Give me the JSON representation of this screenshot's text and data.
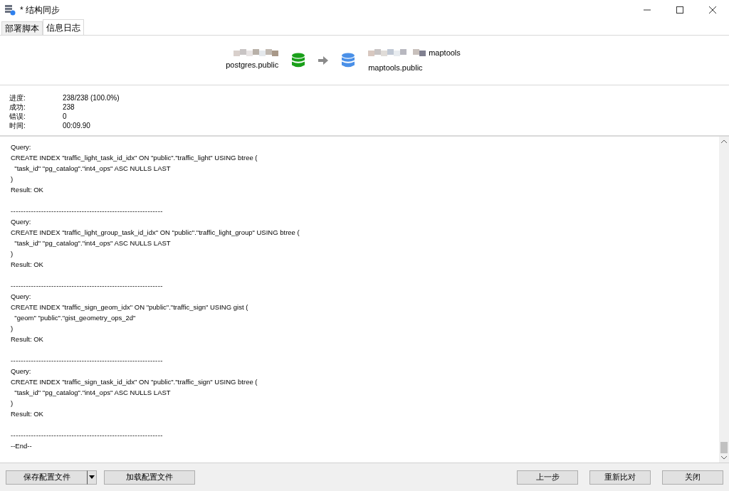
{
  "window": {
    "title": "* 结构同步"
  },
  "tabs": [
    {
      "label": "部署脚本",
      "selected": false
    },
    {
      "label": "信息日志",
      "selected": true
    }
  ],
  "source": {
    "schema": "postgres.public"
  },
  "target": {
    "name_suffix": "maptools",
    "schema": "maptools.public"
  },
  "stats": [
    {
      "label": "进度:",
      "value": "238/238 (100.0%)"
    },
    {
      "label": "成功:",
      "value": "238"
    },
    {
      "label": "错误:",
      "value": "0"
    },
    {
      "label": "时间:",
      "value": "00:09.90"
    }
  ],
  "log": [
    {
      "kind": "query",
      "label": "Query:",
      "sql": [
        "CREATE INDEX \"traffic_light_task_id_idx\" ON \"public\".\"traffic_light\" USING btree (",
        "  \"task_id\" \"pg_catalog\".\"int4_ops\" ASC NULLS LAST",
        ")"
      ],
      "result": "Result: OK"
    },
    {
      "kind": "separator",
      "text": "------------------------------------------------------------"
    },
    {
      "kind": "query",
      "label": "Query:",
      "sql": [
        "CREATE INDEX \"traffic_light_group_task_id_idx\" ON \"public\".\"traffic_light_group\" USING btree (",
        "  \"task_id\" \"pg_catalog\".\"int4_ops\" ASC NULLS LAST",
        ")"
      ],
      "result": "Result: OK"
    },
    {
      "kind": "separator",
      "text": "------------------------------------------------------------"
    },
    {
      "kind": "query",
      "label": "Query:",
      "sql": [
        "CREATE INDEX \"traffic_sign_geom_idx\" ON \"public\".\"traffic_sign\" USING gist (",
        "  \"geom\" \"public\".\"gist_geometry_ops_2d\"",
        ")"
      ],
      "result": "Result: OK"
    },
    {
      "kind": "separator",
      "text": "------------------------------------------------------------"
    },
    {
      "kind": "query",
      "label": "Query:",
      "sql": [
        "CREATE INDEX \"traffic_sign_task_id_idx\" ON \"public\".\"traffic_sign\" USING btree (",
        "  \"task_id\" \"pg_catalog\".\"int4_ops\" ASC NULLS LAST",
        ")"
      ],
      "result": "Result: OK"
    },
    {
      "kind": "separator",
      "text": "------------------------------------------------------------"
    },
    {
      "kind": "end",
      "text": "--End--"
    }
  ],
  "left_buttons": [
    {
      "label": "保存配置文件",
      "kind": "split"
    },
    {
      "label": "加载配置文件",
      "kind": "plain"
    }
  ],
  "right_buttons": [
    "上一步",
    "重新比对",
    "关闭"
  ]
}
